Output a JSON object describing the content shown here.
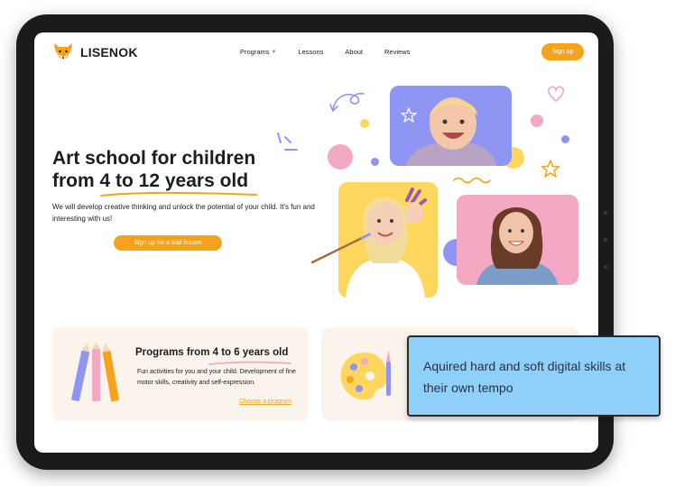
{
  "brand": {
    "name": "LISENOK",
    "logo_icon": "fox-icon"
  },
  "nav": {
    "items": [
      {
        "label": "Programs",
        "has_dropdown": true
      },
      {
        "label": "Lessons"
      },
      {
        "label": "About"
      },
      {
        "label": "Reviews"
      }
    ],
    "signup_label": "Sign up"
  },
  "hero": {
    "title_line1": "Art school for children",
    "title_line2_prefix": "from ",
    "title_line2_highlight": "4 to 12 years old",
    "text": "We will develop creative thinking and unlock the potential of your child. It's fun and interesting with us!",
    "cta_label": "Sign up for a trial lesson"
  },
  "program_card": {
    "title_prefix": "Programs from ",
    "title_highlight": "4 to 6 years old",
    "text": "Fun activities for you and your child. Development of fine motor skills, creativity and self-expression.",
    "link_label": "Choose a program",
    "icon": "pencils-icon"
  },
  "second_card": {
    "icon": "palette-icon"
  },
  "overlay": {
    "text": "Aquired hard and soft digital skills at their own tempo"
  },
  "colors": {
    "accent": "#f7a21b",
    "lavender": "#8f95f2",
    "yellow": "#ffd75e",
    "pink": "#f3a8c4",
    "overlay_bg": "#8fd0fb"
  }
}
